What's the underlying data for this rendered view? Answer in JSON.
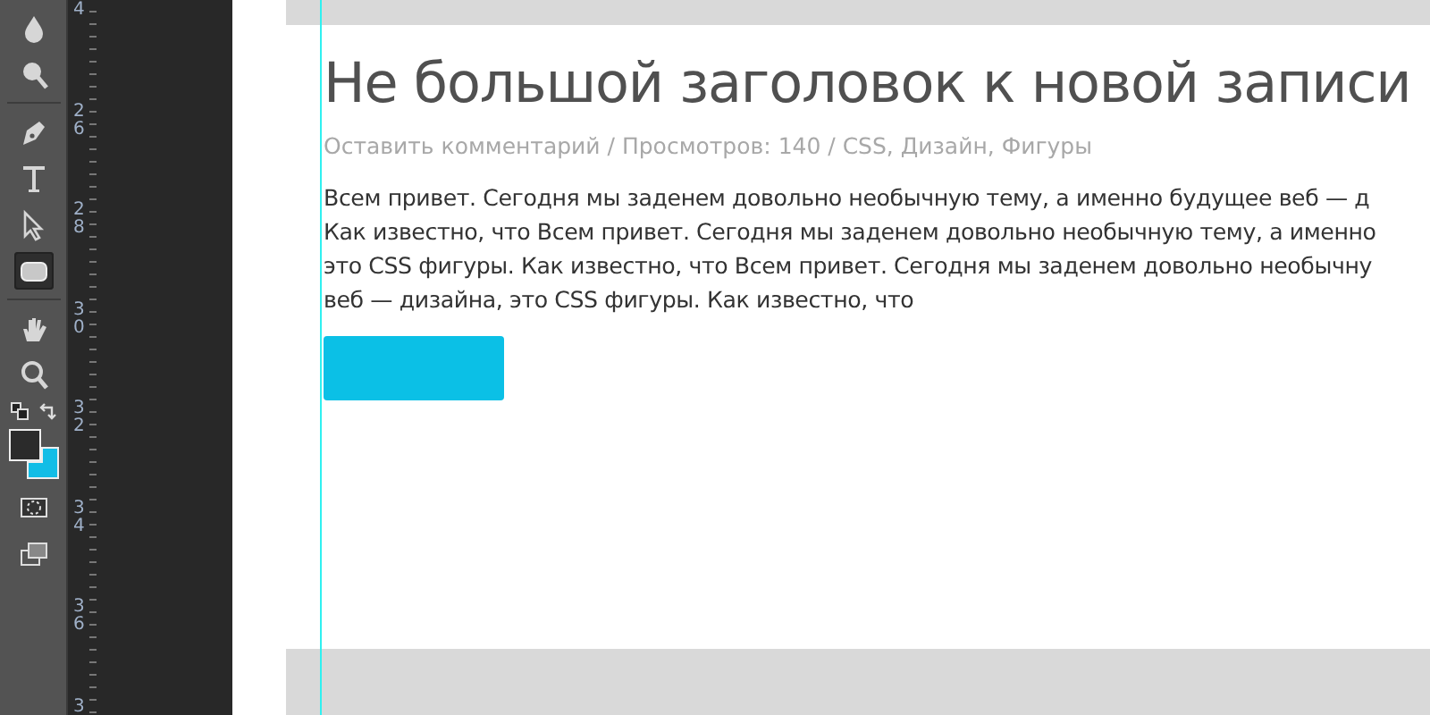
{
  "toolbar": {
    "tools": [
      {
        "kind": "blur",
        "selected": false
      },
      {
        "kind": "dodge",
        "selected": false
      },
      {
        "kind": "pen",
        "selected": false
      },
      {
        "kind": "type",
        "selected": false
      },
      {
        "kind": "select",
        "selected": false
      },
      {
        "kind": "shape",
        "selected": true
      },
      {
        "kind": "hand",
        "selected": false
      },
      {
        "kind": "zoom",
        "selected": false
      }
    ],
    "swatches": [
      {
        "kind": "foreground",
        "color": "#2b2b2b"
      },
      {
        "kind": "background",
        "color": "#12bde6"
      }
    ]
  },
  "ruler": {
    "labels": [
      "4",
      "26",
      "28",
      "30",
      "32",
      "34",
      "36",
      "3"
    ]
  },
  "post": {
    "title": "Не большой заголовок к новой записи",
    "meta": "Оставить комментарий / Просмотров: 140 / CSS, Дизайн, Фигуры",
    "lines": [
      "Всем привет. Сегодня мы заденем довольно необычную тему, а именно будущее веб — д",
      "Как известно, что Всем привет. Сегодня мы заденем довольно необычную тему, а именно",
      "это CSS фигуры. Как известно, что Всем привет. Сегодня мы заденем довольно необычну",
      "веб — дизайна, это CSS фигуры. Как известно, что"
    ]
  }
}
